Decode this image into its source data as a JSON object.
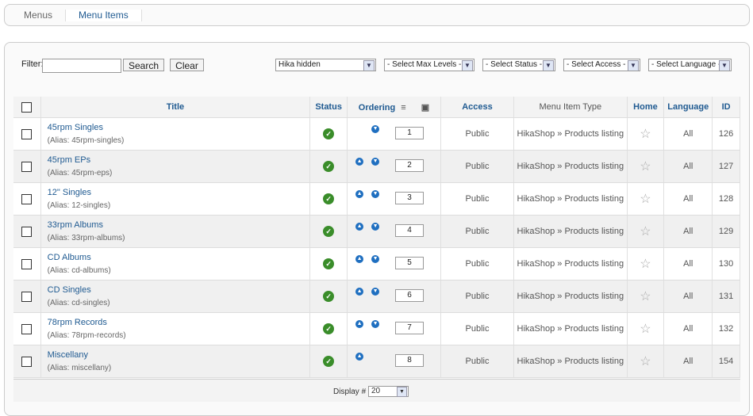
{
  "tabs": {
    "menus": "Menus",
    "menu_items": "Menu Items"
  },
  "filter": {
    "label": "Filter:",
    "value": "",
    "search": "Search",
    "clear": "Clear"
  },
  "selects": {
    "menu": "Hika hidden",
    "max_levels": "- Select Max Levels -",
    "status": "- Select Status -",
    "access": "- Select Access -",
    "language": "- Select Language -"
  },
  "columns": {
    "title": "Title",
    "status": "Status",
    "ordering": "Ordering",
    "access": "Access",
    "type": "Menu Item Type",
    "home": "Home",
    "language": "Language",
    "id": "ID"
  },
  "alias_prefix": "(Alias: ",
  "rows": [
    {
      "title": "45rpm Singles",
      "alias": "(Alias: 45rpm-singles)",
      "order": "1",
      "access": "Public",
      "type": "HikaShop » Products listing",
      "language": "All",
      "id": "126",
      "up": false,
      "down": true
    },
    {
      "title": "45rpm EPs",
      "alias": "(Alias: 45rpm-eps)",
      "order": "2",
      "access": "Public",
      "type": "HikaShop » Products listing",
      "language": "All",
      "id": "127",
      "up": true,
      "down": true
    },
    {
      "title": "12\" Singles",
      "alias": "(Alias: 12-singles)",
      "order": "3",
      "access": "Public",
      "type": "HikaShop » Products listing",
      "language": "All",
      "id": "128",
      "up": true,
      "down": true
    },
    {
      "title": "33rpm Albums",
      "alias": "(Alias: 33rpm-albums)",
      "order": "4",
      "access": "Public",
      "type": "HikaShop » Products listing",
      "language": "All",
      "id": "129",
      "up": true,
      "down": true
    },
    {
      "title": "CD Albums",
      "alias": "(Alias: cd-albums)",
      "order": "5",
      "access": "Public",
      "type": "HikaShop » Products listing",
      "language": "All",
      "id": "130",
      "up": true,
      "down": true
    },
    {
      "title": "CD Singles",
      "alias": "(Alias: cd-singles)",
      "order": "6",
      "access": "Public",
      "type": "HikaShop » Products listing",
      "language": "All",
      "id": "131",
      "up": true,
      "down": true
    },
    {
      "title": "78rpm Records",
      "alias": "(Alias: 78rpm-records)",
      "order": "7",
      "access": "Public",
      "type": "HikaShop » Products listing",
      "language": "All",
      "id": "132",
      "up": true,
      "down": true
    },
    {
      "title": "Miscellany",
      "alias": "(Alias: miscellany)",
      "order": "8",
      "access": "Public",
      "type": "HikaShop » Products listing",
      "language": "All",
      "id": "154",
      "up": true,
      "down": false
    }
  ],
  "footer": {
    "display_label": "Display #",
    "display_value": "20"
  },
  "colors": {
    "link": "#1f5a91",
    "status_ok": "#3a8d2a",
    "arrow": "#1f6fc0"
  }
}
